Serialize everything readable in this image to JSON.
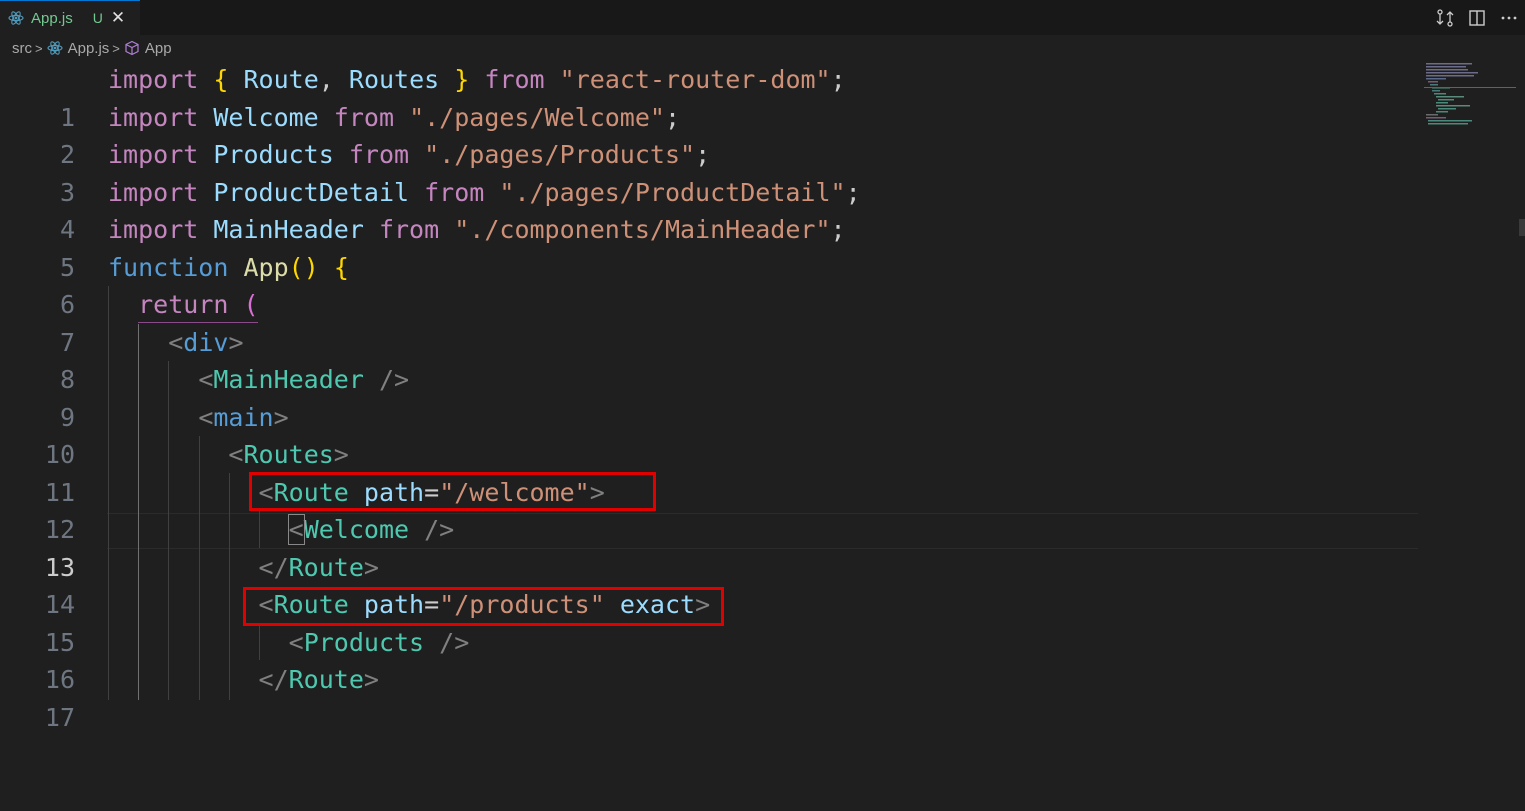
{
  "tab": {
    "filename": "App.js",
    "status": "U",
    "close_glyph": "✕"
  },
  "tab_actions": [
    {
      "name": "compare-changes-icon",
      "glyph": "⇆"
    },
    {
      "name": "split-editor-icon",
      "glyph": "◫"
    },
    {
      "name": "more-actions-icon",
      "glyph": "···"
    }
  ],
  "breadcrumb": {
    "folder": "src",
    "file": "App.js",
    "symbol": "App",
    "separator": ">"
  },
  "editor": {
    "active_line": 13,
    "line_numbers": [
      "1",
      "2",
      "3",
      "4",
      "5",
      "6",
      "7",
      "8",
      "9",
      "10",
      "11",
      "12",
      "13",
      "14",
      "15",
      "16",
      "17"
    ],
    "tokens": {
      "import": "import",
      "from": "from",
      "function": "function",
      "return": "return",
      "route_lbrace": "{",
      "route_rbrace": "}",
      "Route": "Route",
      "Routes": "Routes",
      "comma": ",",
      "semicolon": ";",
      "react_router_dom": "\"react-router-dom\"",
      "Welcome": "Welcome",
      "welcome_path": "\"./pages/Welcome\"",
      "Products": "Products",
      "products_path": "\"./pages/Products\"",
      "ProductDetail": "ProductDetail",
      "productdetail_path": "\"./pages/ProductDetail\"",
      "MainHeader": "MainHeader",
      "mainheader_path": "\"./components/MainHeader\"",
      "App": "App",
      "parens": "()",
      "lbrace": "{",
      "lparen": "(",
      "lt": "<",
      "gt": ">",
      "lt_slash": "</",
      "slash_gt": "/>",
      "div": "div",
      "main": "main",
      "path_attr": "path",
      "eq": "=",
      "exact": "exact",
      "route_welcome": "\"/welcome\"",
      "route_products": "\"/products\""
    }
  },
  "colors": {
    "accent": "#0078d4",
    "highlight_box": "#e00000",
    "modified": "#73c991"
  }
}
